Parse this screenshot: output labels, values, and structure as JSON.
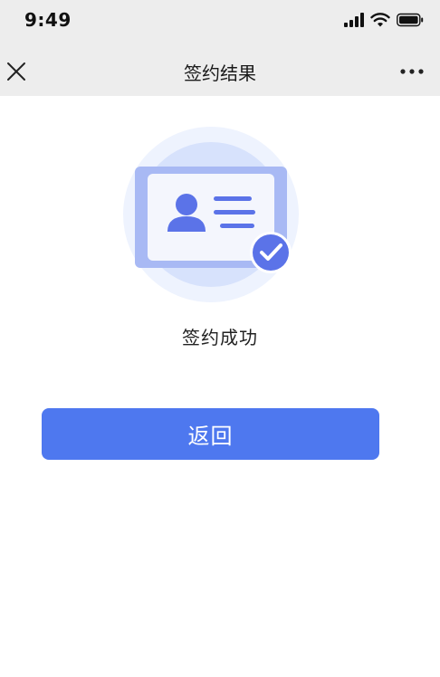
{
  "status_bar": {
    "time": "9:49",
    "icons": [
      "signal-icon",
      "wifi-icon",
      "battery-icon"
    ]
  },
  "nav": {
    "title": "签约结果",
    "left_icon": "close-icon",
    "right_icon": "more-icon"
  },
  "result": {
    "illustration_icon": "id-card-check-icon",
    "message": "签约成功"
  },
  "actions": {
    "return_label": "返回"
  },
  "colors": {
    "nav_background": "#ededed",
    "primary": "#4e78ef",
    "illustration_light": "#eef3fe",
    "illustration_mid": "#d7e2fc",
    "illustration_dark": "#5b73e8"
  }
}
